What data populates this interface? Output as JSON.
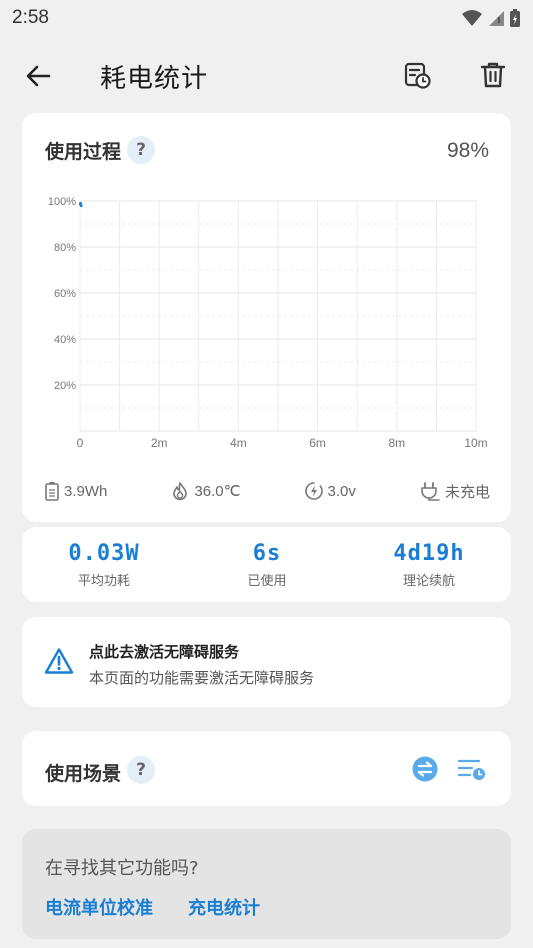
{
  "status": {
    "time": "2:58"
  },
  "appbar": {
    "title": "耗电统计"
  },
  "usage": {
    "title": "使用过程",
    "help": "?",
    "percent": "98%",
    "stats": {
      "energy": "3.9Wh",
      "temperature": "36.0℃",
      "voltage": "3.0v",
      "charging": "未充电"
    }
  },
  "chart_data": {
    "type": "line",
    "x_tick_labels": [
      "0",
      "2m",
      "4m",
      "6m",
      "8m",
      "10m"
    ],
    "y_tick_labels": [
      "20%",
      "40%",
      "60%",
      "80%",
      "100%"
    ],
    "xlim": [
      0,
      10
    ],
    "ylim": [
      0,
      100
    ],
    "grid": true,
    "series": [
      {
        "x": [
          0,
          0.02
        ],
        "y": [
          99,
          98
        ],
        "color": "#1a7fd4"
      }
    ]
  },
  "metrics": [
    {
      "value": "0.03W",
      "label": "平均功耗"
    },
    {
      "value": "6s",
      "label": "已使用"
    },
    {
      "value": "4d19h",
      "label": "理论续航"
    }
  ],
  "accessibility": {
    "title": "点此去激活无障碍服务",
    "description": "本页面的功能需要激活无障碍服务"
  },
  "scene": {
    "title": "使用场景",
    "help": "?"
  },
  "find": {
    "title": "在寻找其它功能吗?",
    "links": [
      "电流单位校准",
      "充电统计"
    ]
  },
  "colors": {
    "accent": "#1a7fd4",
    "background": "#f0f0f0",
    "card": "#ffffff"
  }
}
